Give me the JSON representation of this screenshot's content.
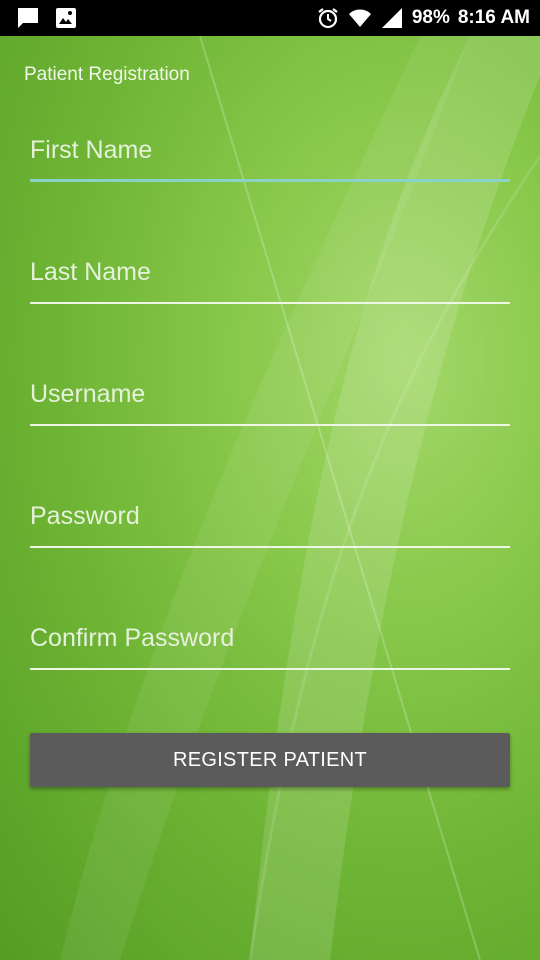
{
  "status_bar": {
    "battery": "98%",
    "time": "8:16 AM",
    "left_icons": [
      "message-icon",
      "image-icon"
    ],
    "right_icons": [
      "alarm-icon",
      "wifi-icon",
      "signal-icon"
    ]
  },
  "page": {
    "title": "Patient Registration"
  },
  "form": {
    "first_name": {
      "placeholder": "First Name",
      "value": ""
    },
    "last_name": {
      "placeholder": "Last Name",
      "value": ""
    },
    "username": {
      "placeholder": "Username",
      "value": ""
    },
    "password": {
      "placeholder": "Password",
      "value": ""
    },
    "confirm_password": {
      "placeholder": "Confirm Password",
      "value": ""
    }
  },
  "actions": {
    "register_label": "REGISTER PATIENT"
  },
  "colors": {
    "background_green": "#6fb535",
    "button_gray": "#5b5b5b",
    "focus_underline": "#8ad1c8"
  }
}
